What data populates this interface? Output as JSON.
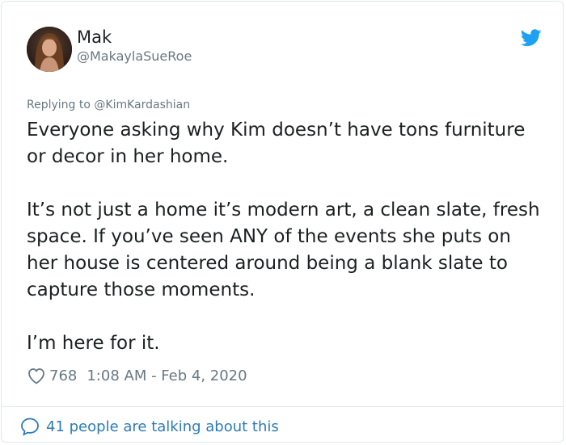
{
  "author": {
    "name": "Mak",
    "handle": "@MakaylaSueRoe"
  },
  "reply": {
    "prefix": "Replying to ",
    "mention": "@KimKardashian"
  },
  "tweet": {
    "paragraph_1": "Everyone asking why Kim doesn’t have tons furniture or decor in her home.",
    "paragraph_2": "It’s not just a home it’s modern art, a clean slate, fresh space. If you’ve seen ANY of the events she puts on her house is centered around being a blank slate to capture those moments.",
    "paragraph_3": "I’m here for it."
  },
  "meta": {
    "likes": "768",
    "timestamp": "1:08 AM - Feb 4, 2020"
  },
  "footer": {
    "conversation_label": "41 people are talking about this"
  },
  "icons": {
    "brand": "twitter-bird-icon",
    "like": "heart-icon",
    "conversation": "speech-bubble-icon"
  },
  "colors": {
    "brand_blue": "#1da1f2",
    "link_blue": "#2b7bb9",
    "muted": "#697882",
    "text": "#1c2022"
  }
}
